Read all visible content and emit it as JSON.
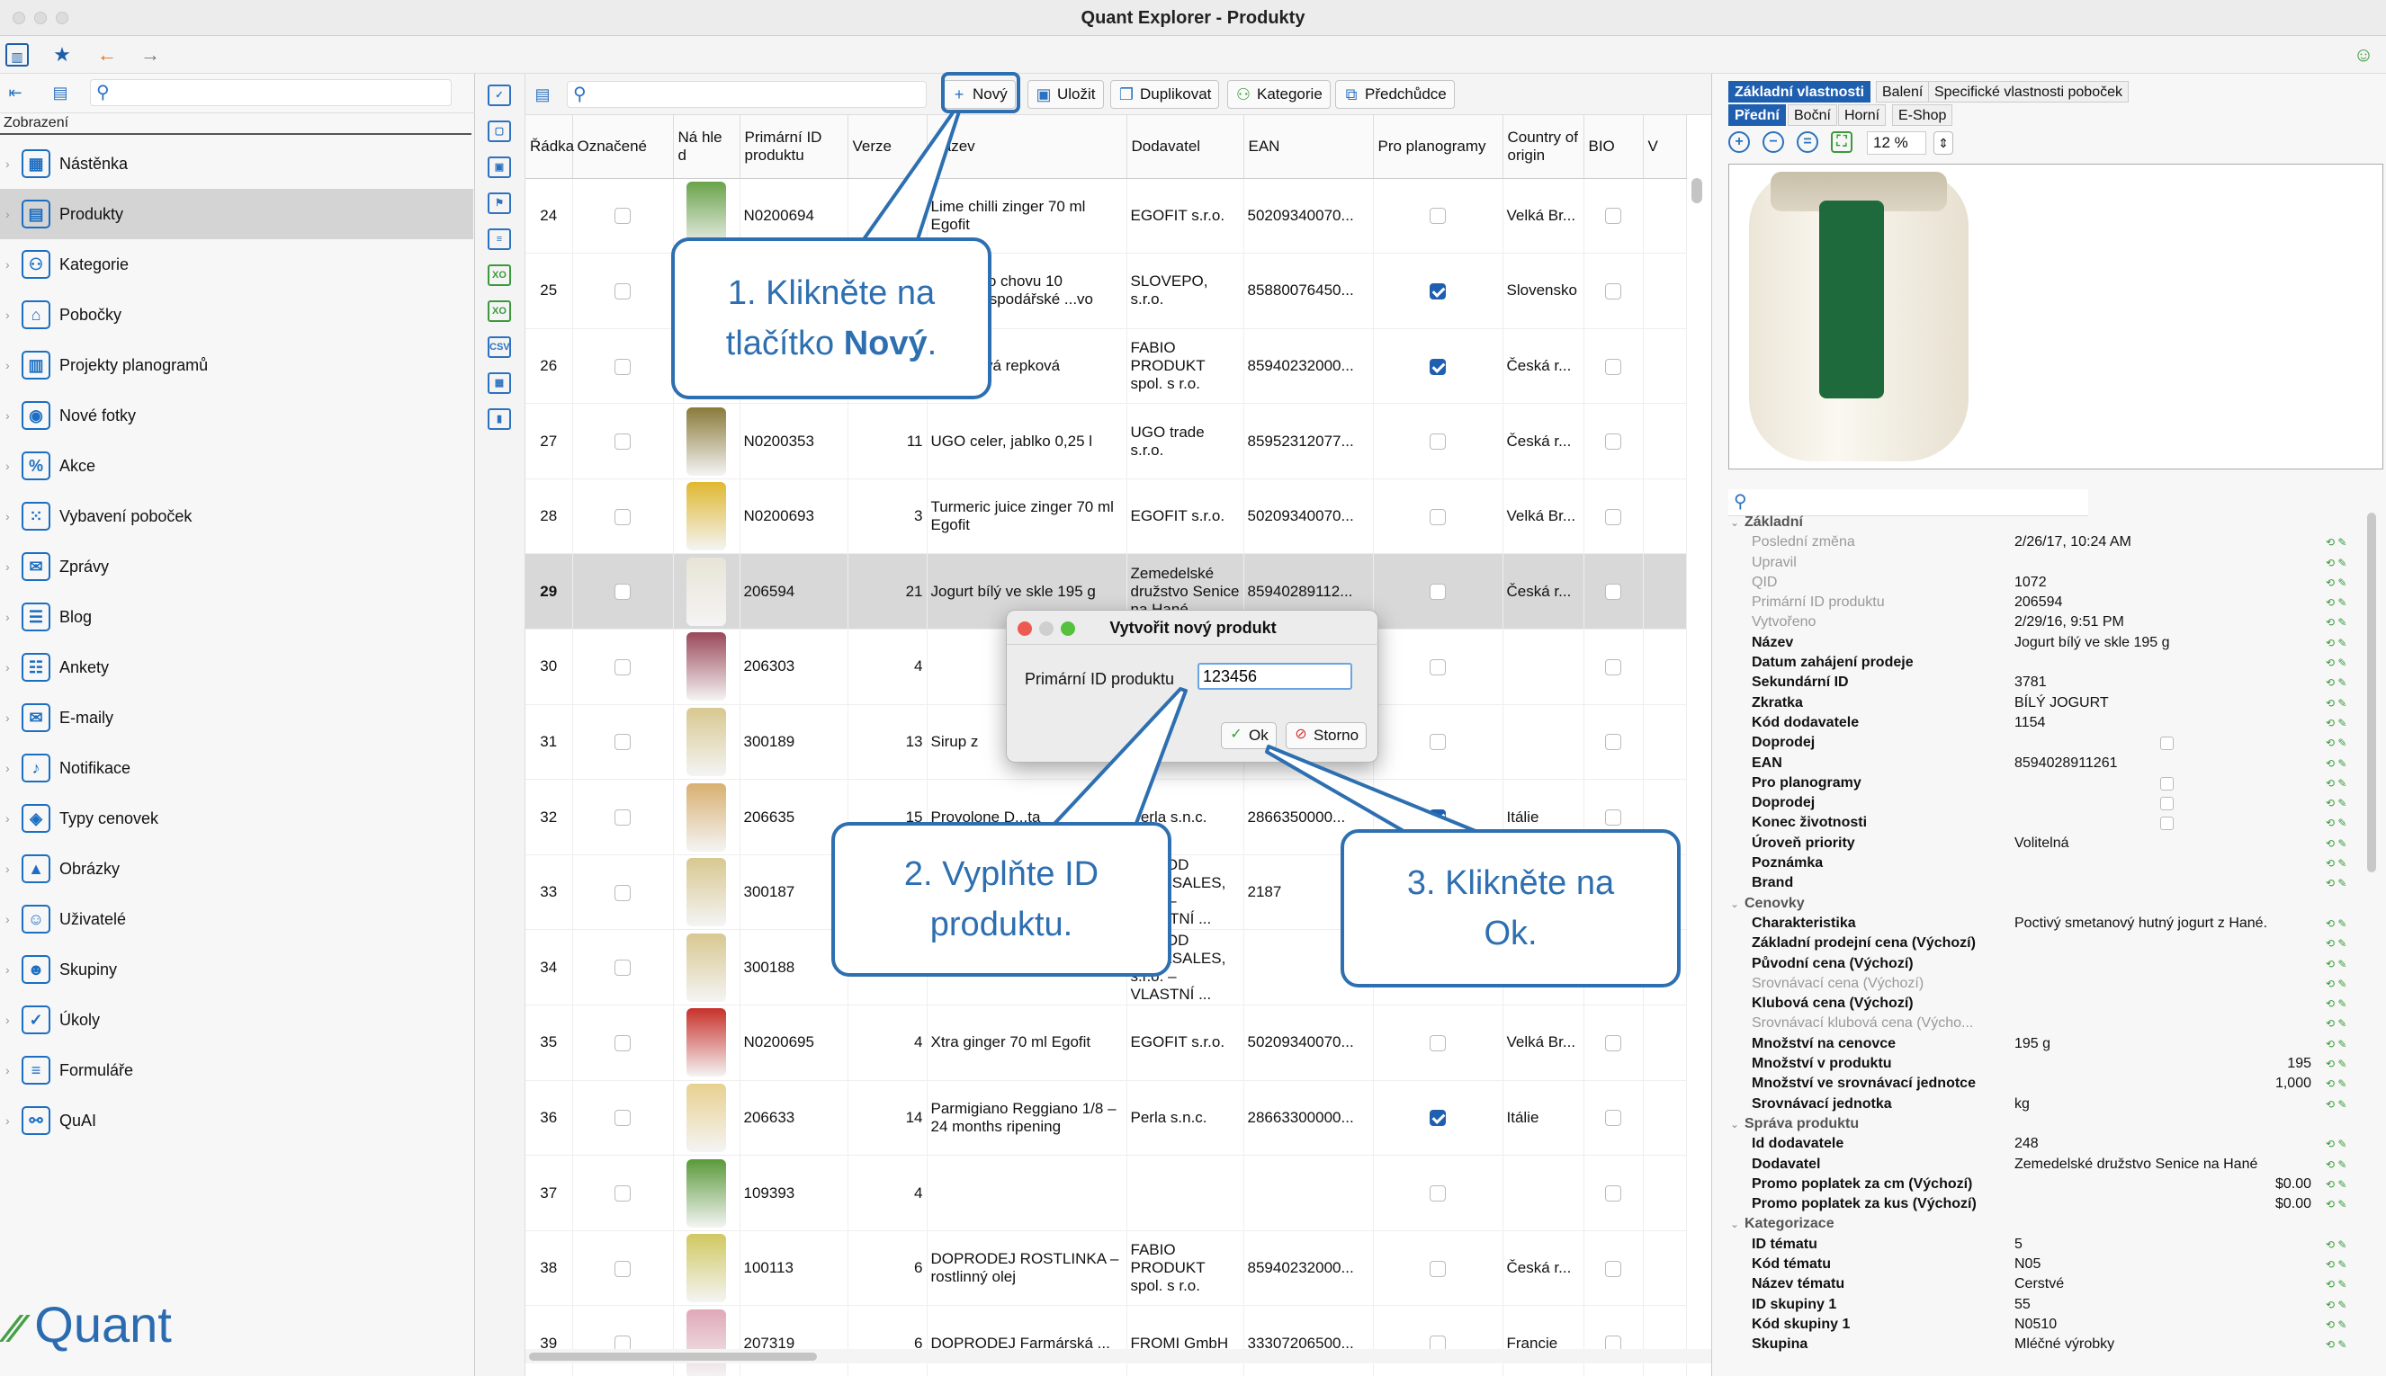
{
  "window": {
    "title": "Quant Explorer - Produkty"
  },
  "left": {
    "view_label": "Zobrazení",
    "items": [
      {
        "label": "Nástěnka",
        "icon": "dashboard-icon",
        "glyph": "▦"
      },
      {
        "label": "Produkty",
        "icon": "products-icon",
        "glyph": "▤"
      },
      {
        "label": "Kategorie",
        "icon": "categories-icon",
        "glyph": "⚇"
      },
      {
        "label": "Pobočky",
        "icon": "stores-icon",
        "glyph": "⌂"
      },
      {
        "label": "Projekty planogramů",
        "icon": "planogram-icon",
        "glyph": "▥"
      },
      {
        "label": "Nové fotky",
        "icon": "camera-icon",
        "glyph": "◉"
      },
      {
        "label": "Akce",
        "icon": "promo-icon",
        "glyph": "%"
      },
      {
        "label": "Vybavení poboček",
        "icon": "equipment-icon",
        "glyph": "⁙"
      },
      {
        "label": "Zprávy",
        "icon": "messages-icon",
        "glyph": "✉"
      },
      {
        "label": "Blog",
        "icon": "blog-icon",
        "glyph": "☰"
      },
      {
        "label": "Ankety",
        "icon": "survey-icon",
        "glyph": "☷"
      },
      {
        "label": "E-maily",
        "icon": "email-icon",
        "glyph": "✉"
      },
      {
        "label": "Notifikace",
        "icon": "bell-icon",
        "glyph": "♪"
      },
      {
        "label": "Typy cenovek",
        "icon": "price-tag-icon",
        "glyph": "◈"
      },
      {
        "label": "Obrázky",
        "icon": "image-icon",
        "glyph": "▲"
      },
      {
        "label": "Uživatelé",
        "icon": "user-icon",
        "glyph": "☺"
      },
      {
        "label": "Skupiny",
        "icon": "group-icon",
        "glyph": "☻"
      },
      {
        "label": "Úkoly",
        "icon": "tasks-icon",
        "glyph": "✓"
      },
      {
        "label": "Formuláře",
        "icon": "forms-icon",
        "glyph": "≡"
      },
      {
        "label": "QuAI",
        "icon": "ai-icon",
        "glyph": "⚯"
      }
    ],
    "logo": "Quant"
  },
  "center": {
    "buttons": {
      "new": "Nový",
      "save": "Uložit",
      "duplicate": "Duplikovat",
      "category": "Kategorie",
      "ancestors": "Předchůdce"
    },
    "columns": [
      "Řádka",
      "Označené",
      "Ná hle d",
      "Primární ID produktu",
      "Verze",
      "Název",
      "Dodavatel",
      "EAN",
      "Pro planogramy",
      "Country of origin",
      "BIO",
      "V"
    ],
    "rows": [
      {
        "row": "24",
        "id": "N0200694",
        "ver": "",
        "name": "Lime chilli zinger 70 ml Egofit",
        "sup": "EGOFIT s.r.o.",
        "ean": "50209340070...",
        "plano": false,
        "country": "Velká Br...",
        "thumb": "#6aa34a"
      },
      {
        "row": "25",
        "id": "",
        "ver": "",
        "name": "z volného chovu 10 mělnohospodářské ...vo",
        "sup": "SLOVEPO, s.r.o.",
        "ean": "85880076450...",
        "plano": true,
        "country": "Slovensko",
        "thumb": ""
      },
      {
        "row": "26",
        "id": "",
        "ver": "",
        "name": "A máslová repková",
        "sup": "FABIO PRODUKT spol. s r.o.",
        "ean": "85940232000...",
        "plano": true,
        "country": "Česká r...",
        "thumb": ""
      },
      {
        "row": "27",
        "id": "N0200353",
        "ver": "11",
        "name": "UGO celer, jablko 0,25 l",
        "sup": "UGO trade s.r.o.",
        "ean": "85952312077...",
        "plano": false,
        "country": "Česká r...",
        "thumb": "#8a7a3a"
      },
      {
        "row": "28",
        "id": "N0200693",
        "ver": "3",
        "name": "Turmeric juice zinger 70 ml Egofit",
        "sup": "EGOFIT s.r.o.",
        "ean": "50209340070...",
        "plano": false,
        "country": "Velká Br...",
        "thumb": "#e0b830"
      },
      {
        "row": "29",
        "id": "206594",
        "ver": "21",
        "name": "Jogurt bílý ve skle 195 g",
        "sup": "Zemedelské družstvo Senice na Hané",
        "ean": "85940289112...",
        "plano": false,
        "country": "Česká r...",
        "thumb": "#e8e4d6",
        "sel": true
      },
      {
        "row": "30",
        "id": "206303",
        "ver": "4",
        "name": "",
        "sup": "",
        "ean": "",
        "plano": false,
        "country": "",
        "thumb": "#9a4858"
      },
      {
        "row": "31",
        "id": "300189",
        "ver": "13",
        "name": "Sirup z",
        "sup": "VLASTNÍ ...",
        "ean": "",
        "plano": false,
        "country": "",
        "thumb": "#d8c890"
      },
      {
        "row": "32",
        "id": "206635",
        "ver": "15",
        "name": "Provolone D...ta",
        "sup": "Perla s.n.c.",
        "ean": "2866350000...",
        "plano": true,
        "country": "Itálie",
        "thumb": "#d8b070"
      },
      {
        "row": "33",
        "id": "300187",
        "ver": "",
        "name": "",
        "sup": "Y FOOD HOLESALES, s.r.o. – VLASTNÍ ...",
        "ean": "2187",
        "plano": false,
        "country": "",
        "thumb": "#d8c890"
      },
      {
        "row": "34",
        "id": "300188",
        "ver": "",
        "name": "",
        "sup": "Y FOOD HOLESALES, s.r.o. – VLASTNÍ ...",
        "ean": "",
        "plano": false,
        "country": "",
        "thumb": "#d8c890"
      },
      {
        "row": "35",
        "id": "N0200695",
        "ver": "4",
        "name": "Xtra ginger 70 ml Egofit",
        "sup": "EGOFIT s.r.o.",
        "ean": "50209340070...",
        "plano": false,
        "country": "Velká Br...",
        "thumb": "#c8302a"
      },
      {
        "row": "36",
        "id": "206633",
        "ver": "14",
        "name": "Parmigiano Reggiano 1/8 – 24 months ripening",
        "sup": "Perla s.n.c.",
        "ean": "28663300000...",
        "plano": true,
        "country": "Itálie",
        "thumb": "#e8d090"
      },
      {
        "row": "37",
        "id": "109393",
        "ver": "4",
        "name": "",
        "sup": "",
        "ean": "",
        "plano": false,
        "country": "",
        "thumb": "#5a9a3a"
      },
      {
        "row": "38",
        "id": "100113",
        "ver": "6",
        "name": "DOPRODEJ ROSTLINKA – rostlinný olej",
        "sup": "FABIO PRODUKT spol. s r.o.",
        "ean": "85940232000...",
        "plano": false,
        "country": "Česká r...",
        "thumb": "#d0c860"
      },
      {
        "row": "39",
        "id": "207319",
        "ver": "6",
        "name": "DOPRODEJ Farmárská ...",
        "sup": "FROMI GmbH",
        "ean": "33307206500...",
        "plano": false,
        "country": "Francie",
        "thumb": "#e0a8b8"
      }
    ]
  },
  "dialog": {
    "title": "Vytvořit nový produkt",
    "label": "Primární ID produktu",
    "value": "123456",
    "ok": "Ok",
    "cancel": "Storno"
  },
  "callouts": {
    "c1_line1": "1. Klikněte na",
    "c1_line2_pre": "tlačítko ",
    "c1_line2_bold": "Nový",
    "c1_line2_post": ".",
    "c2": "2. Vyplňte ID produktu.",
    "c3": "3. Klikněte na Ok."
  },
  "right": {
    "tabs_top": [
      "Základní vlastnosti",
      "Balení",
      "Specifické vlastnosti poboček"
    ],
    "tabs_view": [
      "Přední",
      "Boční",
      "Horní",
      "E-Shop"
    ],
    "zoom": "12 %",
    "props": [
      {
        "t": "sec",
        "k": "Základní"
      },
      {
        "k": "Poslední změna",
        "v": "2/26/17, 10:24 AM",
        "s": "g"
      },
      {
        "k": "Upravil",
        "v": "",
        "s": "g"
      },
      {
        "k": "QID",
        "v": "1072",
        "s": "g"
      },
      {
        "k": "Primární ID produktu",
        "v": "206594",
        "s": "g"
      },
      {
        "k": "Vytvořeno",
        "v": "2/29/16, 9:51 PM",
        "s": "g"
      },
      {
        "k": "Název",
        "v": "Jogurt bílý ve skle 195 g",
        "s": "b"
      },
      {
        "k": "Datum zahájení prodeje",
        "v": "",
        "s": "b"
      },
      {
        "k": "Sekundární ID",
        "v": "3781",
        "s": "b"
      },
      {
        "k": "Zkratka",
        "v": "BÍLÝ JOGURT",
        "s": "b"
      },
      {
        "k": "Kód dodavatele",
        "v": "1154",
        "s": "b"
      },
      {
        "k": "Doprodej",
        "v": "",
        "s": "b",
        "cb": true
      },
      {
        "k": "EAN",
        "v": "8594028911261",
        "s": "b"
      },
      {
        "k": "Pro planogramy",
        "v": "",
        "s": "b",
        "cb": true
      },
      {
        "k": "Doprodej",
        "v": "",
        "s": "b",
        "cb": true
      },
      {
        "k": "Konec životnosti",
        "v": "",
        "s": "b",
        "cb": true
      },
      {
        "k": "Úroveň priority",
        "v": "Volitelná",
        "s": "b"
      },
      {
        "k": "Poznámka",
        "v": "",
        "s": "b"
      },
      {
        "k": "Brand",
        "v": "",
        "s": "b"
      },
      {
        "t": "sec",
        "k": "Cenovky"
      },
      {
        "k": "Charakteristika",
        "v": "Poctivý smetanový hutný jogurt z Hané.",
        "s": "b"
      },
      {
        "k": "Základní prodejní cena (Výchozí)",
        "v": "",
        "s": "b"
      },
      {
        "k": "Původní cena (Výchozí)",
        "v": "",
        "s": "b"
      },
      {
        "k": "Srovnávací cena (Výchozí)",
        "v": "",
        "s": "g"
      },
      {
        "k": "Klubová cena (Výchozí)",
        "v": "",
        "s": "b"
      },
      {
        "k": "Srovnávací klubová cena (Výcho...",
        "v": "",
        "s": "g"
      },
      {
        "k": "Množství na cenovce",
        "v": "195 g",
        "s": "b"
      },
      {
        "k": "Množství v produktu",
        "v": "195",
        "s": "b",
        "r": true
      },
      {
        "k": "Množství ve srovnávací jednotce",
        "v": "1,000",
        "s": "b",
        "r": true
      },
      {
        "k": "Srovnávací jednotka",
        "v": "kg",
        "s": "b"
      },
      {
        "t": "sec",
        "k": "Správa produktu"
      },
      {
        "k": "Id dodavatele",
        "v": "248",
        "s": "b"
      },
      {
        "k": "Dodavatel",
        "v": "Zemedelské družstvo Senice na Hané",
        "s": "b"
      },
      {
        "k": "Promo poplatek za cm (Výchozí)",
        "v": "$0.00",
        "s": "b",
        "r": true
      },
      {
        "k": "Promo poplatek za kus (Výchozí)",
        "v": "$0.00",
        "s": "b",
        "r": true
      },
      {
        "t": "sec",
        "k": "Kategorizace"
      },
      {
        "k": "ID tématu",
        "v": "5",
        "s": "b"
      },
      {
        "k": "Kód tématu",
        "v": "N05",
        "s": "b"
      },
      {
        "k": "Název tématu",
        "v": "Cerstvé",
        "s": "b"
      },
      {
        "k": "ID skupiny 1",
        "v": "55",
        "s": "b"
      },
      {
        "k": "Kód skupiny 1",
        "v": "N0510",
        "s": "b"
      },
      {
        "k": "Skupina",
        "v": "Mléčné výrobky",
        "s": "b"
      }
    ]
  }
}
